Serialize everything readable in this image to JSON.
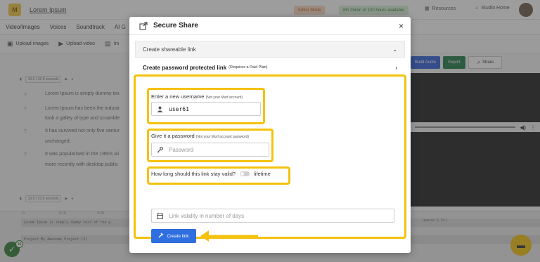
{
  "app": {
    "project_title": "Lorem Ipsum",
    "mode_badge": "Editor Mode",
    "availability": "8th 25min of 120 hours available",
    "resources": "Resources",
    "studio_home": "Studio Home"
  },
  "menu": [
    "Video/Images",
    "Voices",
    "Soundtrack",
    "AI G"
  ],
  "toolbar": {
    "upload_images": "Upload images",
    "upload_video": "Upload video",
    "im": "Im"
  },
  "actions": {
    "build_audio": "Build Audio",
    "export": "Export",
    "share": "Share"
  },
  "editor": {
    "seg1_badge": "33.5 / 35.8 seconds",
    "seg2_badge": "33.5 / 33.5 seconds",
    "lines": [
      "Lorem Ipsum is simply dummy tex",
      "Lorem Ipsum has been the industr",
      "took a galley of type and scramble",
      "It has survived not only five centur",
      "unchanged.",
      "It was popularised in the 1960s wi",
      "more recently with desktop publis"
    ]
  },
  "timeline": {
    "ticks": [
      "0",
      "0:10",
      "0:20"
    ],
    "track1": "Lorem Ipsum is simply dummy text of the p",
    "track2": "Project_My_Awesome_Project (3)",
    "right_tag": "(pause 1.5s)",
    "notif_count": "16"
  },
  "modal": {
    "title": "Secure Share",
    "close": "×",
    "acc1": "Create shareable link",
    "acc2": "Create password protected link",
    "acc2_sub": "(Requires a Paid Plan)",
    "username_label": "Enter a new username",
    "username_note": "(Not your Murf account)",
    "username_value": "user61",
    "password_label": "Give it a password",
    "password_note": "(Not your Murf account password)",
    "password_placeholder": "Password",
    "validity_question": "How long should this link stay valid?",
    "validity_toggle_label": "lifetime",
    "days_placeholder": "Link validity in number of days",
    "create_button": "Create link"
  },
  "colors": {
    "highlight": "#f4c20d",
    "primary": "#2f6fe0",
    "export_green": "#1f7a48"
  },
  "icons": {
    "modal": "share-icon",
    "username": "user-icon",
    "password": "key-icon",
    "days": "calendar-icon",
    "create": "link-icon"
  }
}
